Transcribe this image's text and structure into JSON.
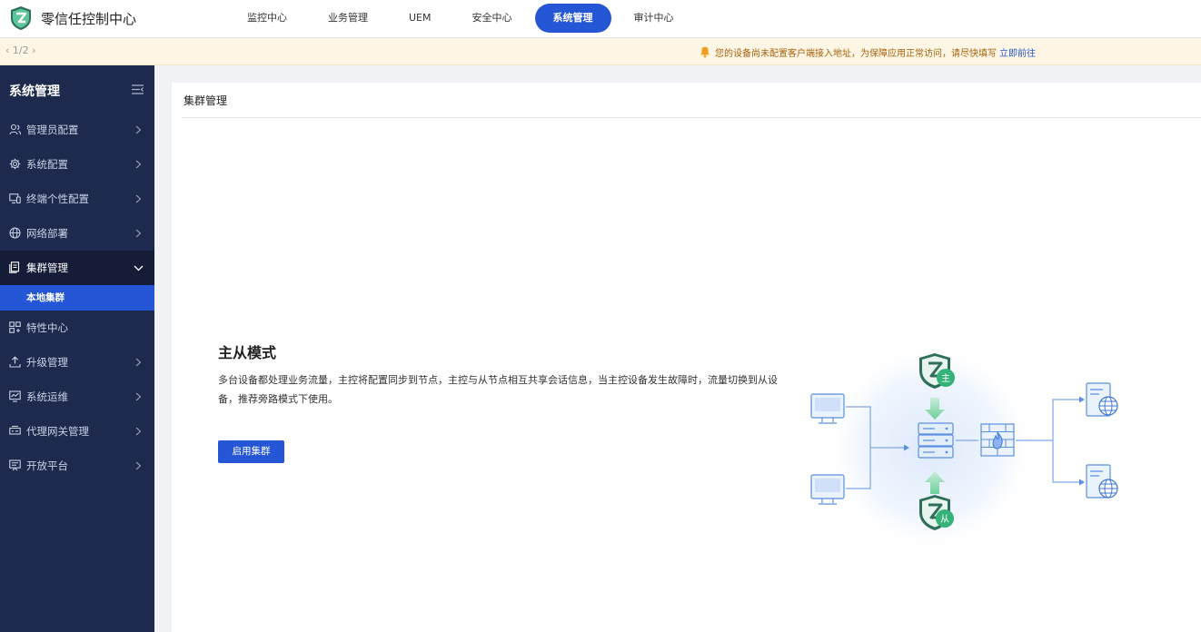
{
  "app": {
    "title": "零信任控制中心"
  },
  "nav": {
    "items": [
      {
        "label": "监控中心",
        "active": false
      },
      {
        "label": "业务管理",
        "active": false
      },
      {
        "label": "UEM",
        "active": false
      },
      {
        "label": "安全中心",
        "active": false
      },
      {
        "label": "系统管理",
        "active": true
      },
      {
        "label": "审计中心",
        "active": false
      }
    ]
  },
  "notice": {
    "pager": "‹ 1/2 ›",
    "text": "您的设备尚未配置客户端接入地址，为保障应用正常访问，请尽快填写",
    "link": "立即前往",
    "bell_color": "#f0a020"
  },
  "sidebar": {
    "title": "系统管理",
    "items": [
      {
        "label": "管理员配置",
        "icon": "user-group-icon"
      },
      {
        "label": "系统配置",
        "icon": "gear-icon"
      },
      {
        "label": "终端个性配置",
        "icon": "devices-icon"
      },
      {
        "label": "网络部署",
        "icon": "globe-icon"
      },
      {
        "label": "集群管理",
        "icon": "cluster-icon",
        "open": true
      },
      {
        "label": "特性中心",
        "icon": "apps-icon"
      },
      {
        "label": "升级管理",
        "icon": "upload-icon"
      },
      {
        "label": "系统运维",
        "icon": "monitor-chart-icon"
      },
      {
        "label": "代理网关管理",
        "icon": "gateway-icon"
      },
      {
        "label": "开放平台",
        "icon": "open-platform-icon"
      }
    ],
    "sub_item": "本地集群"
  },
  "content": {
    "title": "集群管理",
    "mode_title": "主从模式",
    "mode_desc": "多台设备都处理业务流量，主控将配置同步到节点，主控与从节点相互共享会话信息，当主控设备发生故障时，流量切换到从设备，推荐旁路模式下使用。",
    "enable_button": "启用集群",
    "diagram": {
      "master_label": "主",
      "slave_label": "从"
    }
  },
  "colors": {
    "accent": "#2556d6",
    "sidebar_bg": "#1d2a4e",
    "notice_bg": "#fdf6e4",
    "notice_text": "#a5620e",
    "badge_green": "#35b27a"
  }
}
